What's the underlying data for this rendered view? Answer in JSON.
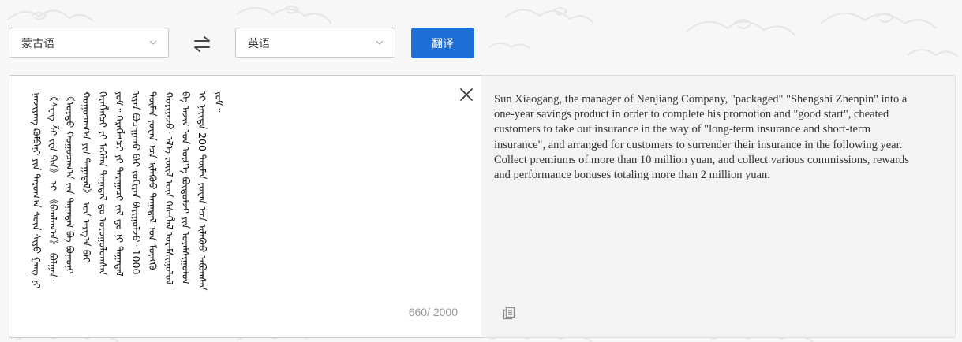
{
  "source_language": {
    "selected": "蒙古语"
  },
  "target_language": {
    "selected": "英语"
  },
  "translate_button": {
    "label": "翻译"
  },
  "source": {
    "text": "ᠨᠡᠨᠵᠢᠶᠠᠩ ᠺᠣᠮᠫᠠᠨᠢ ᠶᠢᠨ ᠳᠠᠷᠤᠭ᠎ᠠ ᠰᠦᠨ ᠰᠢᠶᠣ ᠭᠠᠩ ᠨᠢ 《ᠰᠧᠩ ᠱᠢ ᠵᠧᠨ ᠫᠢᠨ》 ᠢ 《ᠪᠠᠭᠯᠠᠭ᠎ᠠ》 ᠪᠣᠯᠭᠠᠨ᠂ 《ᠤᠷᠲᠤ ᠬᠤᠭᠤᠴᠠᠭ᠎ᠠ ᠶᠢᠨ ᠳᠠᠭᠠᠲᠠᠯ ᠪᠠ ᠪᠣᠭᠣᠨᠢ ᠬᠤᠭᠤᠴᠠᠭ᠎ᠠ ᠶᠢᠨ ᠳᠠᠭᠠᠲᠠᠯ》 ᠤᠨ ᠠᠷᠭ᠎ᠠ ᠪᠠᠷ ᠬᠡᠷᠡᠭᠯᠡᠭᠴᠢ ᠶᠢ ᠮᠡᠬᠡᠯᠡᠨ ᠳᠠᠭᠠᠲᠠᠯ ᠳᠤ ᠣᠷᠣᠭᠣᠯᠤᠭᠰᠠᠨ ᠶᠤᠮ᠃ ᠬᠡᠷᠡᠭᠯᠡᠭᠴᠢ ᠶᠢ ᠳᠠᠷᠠᠭᠠᠴᠢ ᠵᠢᠯ ᠳᠤ ᠨᠢ ᠳᠠᠭᠠᠲᠠᠯ ᠢᠶᠠᠨ ᠪᠤᠴᠠᠭᠠᠬᠤ ᠪᠠᠷ ᠵᠣᠬᠢᠶᠠᠨ ᠪᠠᠶᠢᠭᠤᠯᠵᠤ᠂ 1000 ᠲᠦᠮᠡᠨ ᠶᠤᠸᠠᠨ ᠡᠴᠡ ᠢᠯᠡᠭᠦᠦ ᠳᠠᠭᠠᠲᠠᠯ ᠤᠨ ᠮᠥᠩᠭᠦ ᠬᠤᠷᠢᠶᠠᠵᠤ᠂ ᠡᠯ᠎ᠡ ᠵᠦᠢᠯ ᠦᠨ ᠬᠡᠰᠡᠭᠯᠡᠯ ᠤᠷᠠᠮᠱᠢᠭᠤᠯᠤᠯ ᠪᠠ ᠠᠵᠢᠯ ᠤᠨ ᠦᠷ᠎ᠡ ᠪᠦᠲᠦᠮᠵᠢ ᠶᠢᠨ ᠤᠷᠠᠮᠱᠢᠭᠤᠯᠤᠯ ᠢ ᠨᠡᠶᠢᠲᠡ 200 ᠲᠦᠮᠡᠨ ᠶᠤᠸᠠᠨ ᠡᠴᠡ ᠢᠯᠡᠭᠦᠦ ᠠᠪᠤᠭᠰᠠᠨ ᠶᠤᠮ᠃",
    "char_count": "660/ 2000"
  },
  "target": {
    "text": "Sun Xiaogang, the manager of Nenjiang Company, \"packaged\" \"Shengshi Zhenpin\" into a one-year savings product in order to complete his promotion and \"good start\", cheated customers to take out insurance in the way of \"long-term insurance and short-term insurance\", and arranged for customers to surrender their insurance in the following year. Collect premiums of more than 10 million yuan, and collect various commissions, rewards and performance bonuses totaling more than 2 million yuan."
  },
  "colors": {
    "primary": "#1f6fd6",
    "border": "#c8c8c8",
    "target_bg": "#f3f3f3",
    "page_bg": "#f7f7f7"
  },
  "icons": {
    "swap": "swap-arrows-icon",
    "chevron": "chevron-down-icon",
    "clear": "close-icon",
    "copy": "copy-icon"
  }
}
